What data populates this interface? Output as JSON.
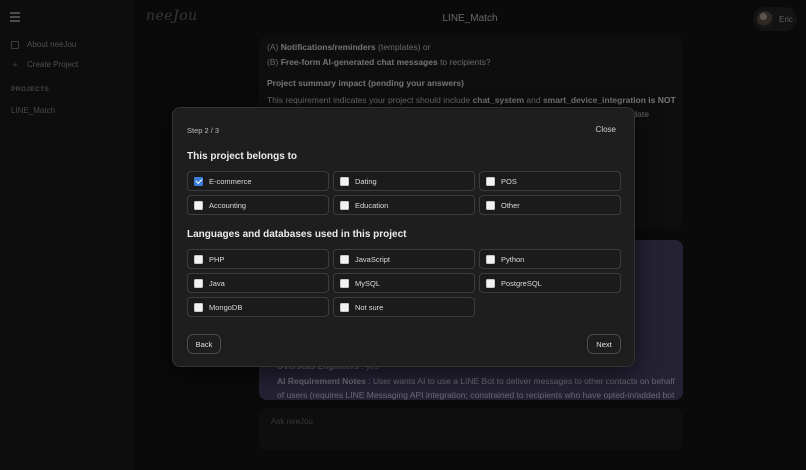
{
  "header": {
    "logo": "neeJou",
    "title": "LINE_Match",
    "user_name": "Eric"
  },
  "sidebar": {
    "items": [
      {
        "label": "About neeJou",
        "icon": "info-box-icon"
      },
      {
        "label": "Create Project",
        "icon": "plus-icon"
      }
    ],
    "projects_heading": "PROJECTS",
    "projects": [
      "LINE_Match"
    ]
  },
  "chat": {
    "line1_prefix": "(A) ",
    "line1_bold": "Notifications/reminders",
    "line1_suffix": " (templates) or",
    "line2_prefix": "(B) ",
    "line2_bold": "Free-form AI-generated chat messages",
    "line2_suffix": " to recipients?",
    "summary_heading": "Project summary impact (pending your answers)",
    "summary_text": "This requirement indicates your project should include ",
    "summary_bold1": "chat_system",
    "summary_and": " and ",
    "summary_bold2": "smart_device_integration is NOT",
    "summary_tail": "update",
    "purple_line1_bold": "Overseas Engineers",
    "purple_line1_rest": " : yes",
    "purple_line2_bold": "AI Requirement Notes",
    "purple_line2_rest": " :  User wants AI to use a LINE Bot to deliver messages to other contacts on behalf",
    "purple_line3": "of users (requires LINE Messaging API integration; constrained to recipients who have opted-in/added bot"
  },
  "ask": {
    "placeholder": "Ask neeJou"
  },
  "modal": {
    "step": "Step 2 / 3",
    "close_label": "Close",
    "section1_title": "This project belongs to",
    "industries": [
      {
        "label": "E-commerce",
        "checked": true
      },
      {
        "label": "Dating",
        "checked": false
      },
      {
        "label": "POS",
        "checked": false
      },
      {
        "label": "Accounting",
        "checked": false
      },
      {
        "label": "Education",
        "checked": false
      },
      {
        "label": "Other",
        "checked": false
      }
    ],
    "section2_title": "Languages and databases used in this project",
    "techs": [
      {
        "label": "PHP",
        "checked": false
      },
      {
        "label": "JavaScript",
        "checked": false
      },
      {
        "label": "Python",
        "checked": false
      },
      {
        "label": "Java",
        "checked": false
      },
      {
        "label": "MySQL",
        "checked": false
      },
      {
        "label": "PostgreSQL",
        "checked": false
      },
      {
        "label": "MongoDB",
        "checked": false
      },
      {
        "label": "Not sure",
        "checked": false
      }
    ],
    "back_label": "Back",
    "next_label": "Next"
  },
  "colors": {
    "accent": "#3b7ddd",
    "purple_card": "#4b4468",
    "background": "#141414"
  }
}
